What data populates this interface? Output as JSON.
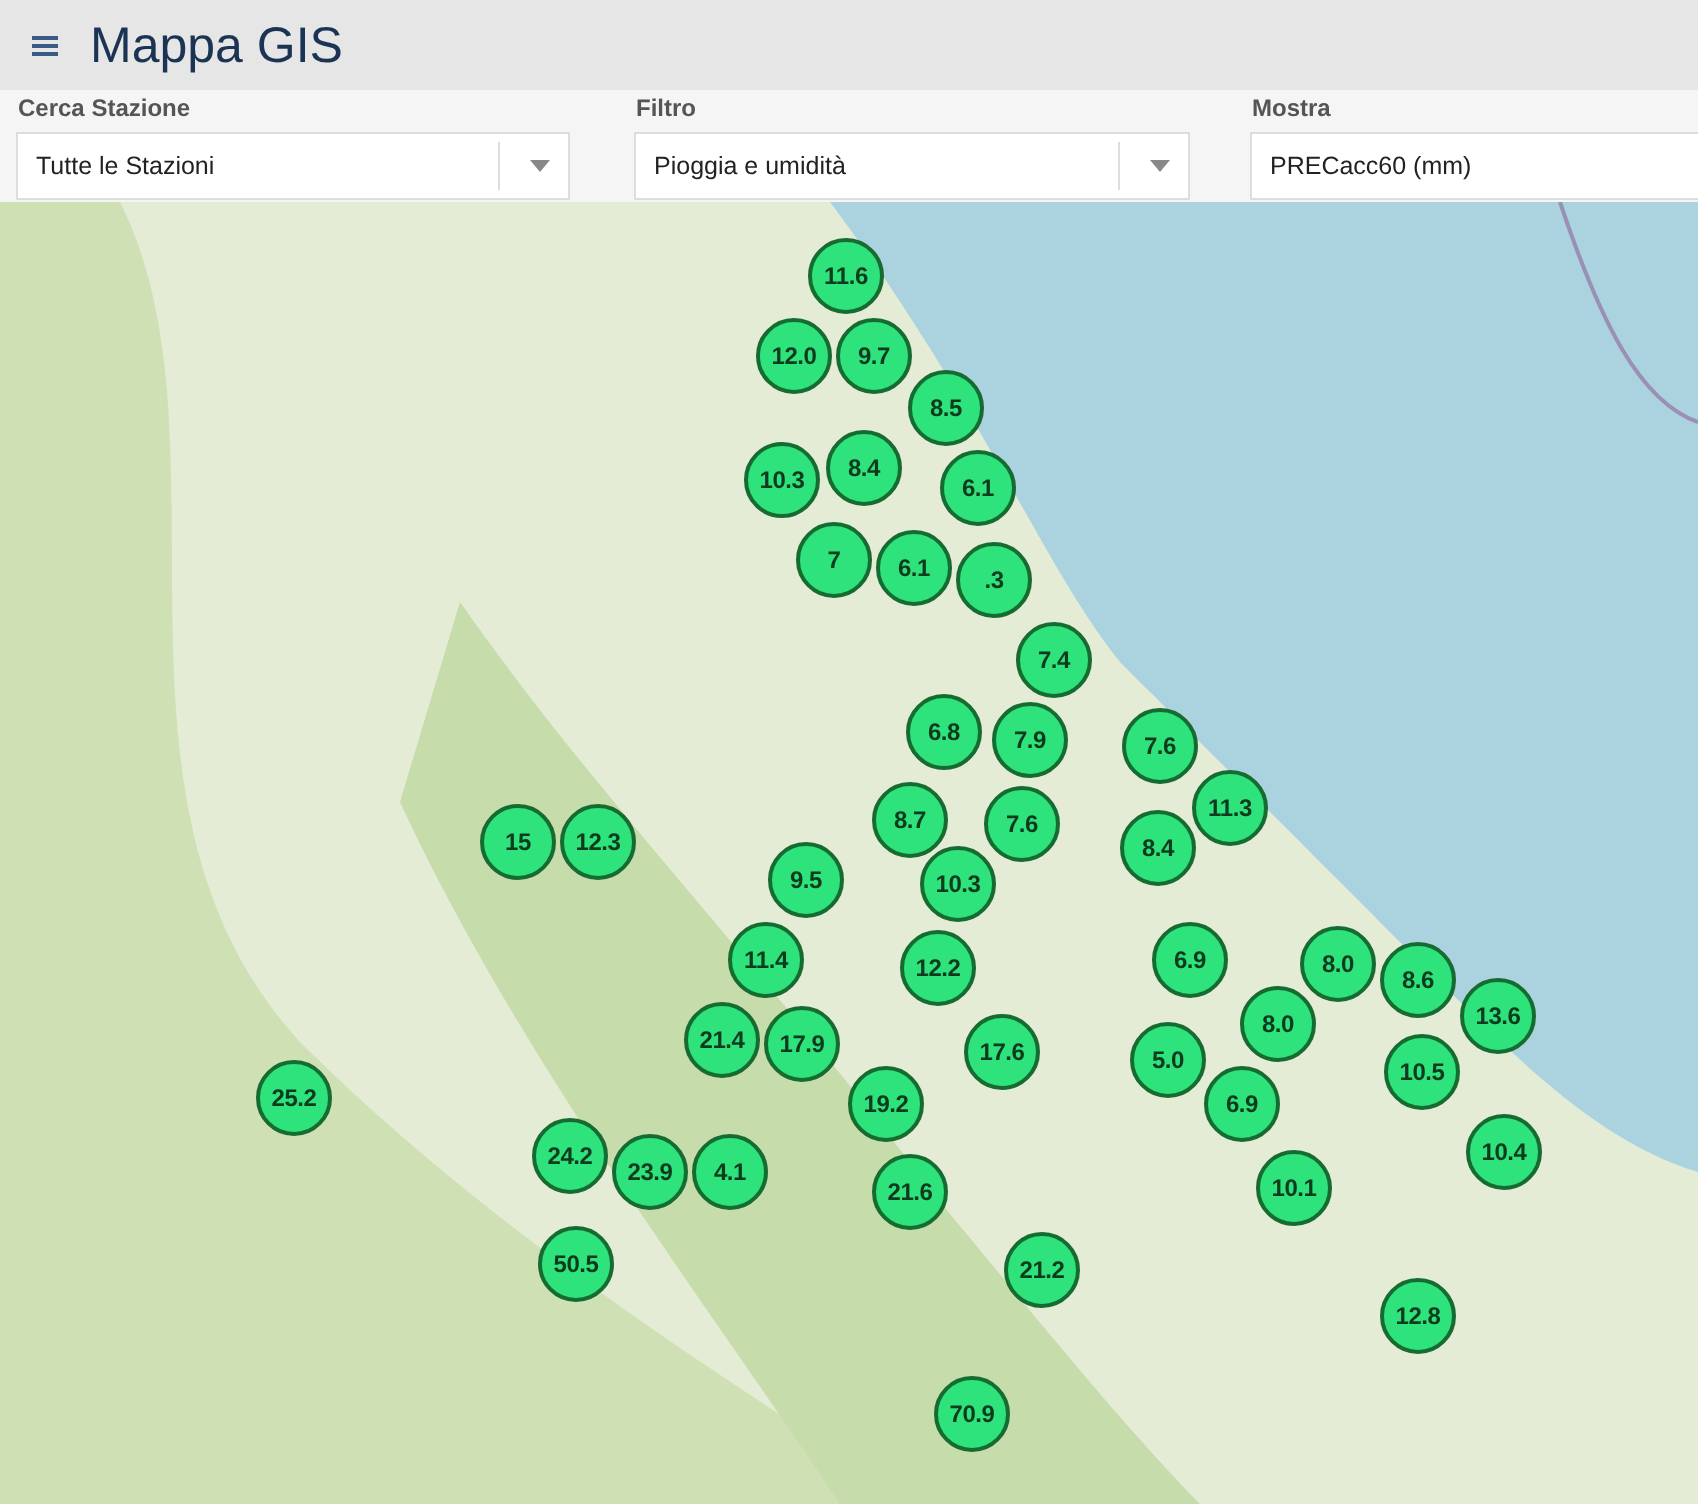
{
  "header": {
    "title": "Mappa GIS"
  },
  "filters": [
    {
      "label": "Cerca Stazione",
      "value": "Tutte le Stazioni",
      "kind": "dropdown"
    },
    {
      "label": "Filtro",
      "value": "Pioggia e umidità",
      "kind": "dropdown"
    },
    {
      "label": "Mostra",
      "value": "PRECacc60 (mm)",
      "kind": "text"
    }
  ],
  "map": {
    "markers": [
      {
        "value": "11.6"
      },
      {
        "value": "12.0"
      },
      {
        "value": "9.7"
      },
      {
        "value": "8.5"
      },
      {
        "value": "10.3"
      },
      {
        "value": "8.4"
      },
      {
        "value": "6.1"
      },
      {
        "value": "7"
      },
      {
        "value": "6.1"
      },
      {
        "value": ".3"
      },
      {
        "value": "7.4"
      },
      {
        "value": "6.8"
      },
      {
        "value": "7.9"
      },
      {
        "value": "7.6"
      },
      {
        "value": "15"
      },
      {
        "value": "12.3"
      },
      {
        "value": "8.7"
      },
      {
        "value": "7.6"
      },
      {
        "value": "8.4"
      },
      {
        "value": "11.3"
      },
      {
        "value": "9.5"
      },
      {
        "value": "10.3"
      },
      {
        "value": "11.4"
      },
      {
        "value": "12.2"
      },
      {
        "value": "6.9"
      },
      {
        "value": "8.0"
      },
      {
        "value": "8.6"
      },
      {
        "value": "21.4"
      },
      {
        "value": "17.9"
      },
      {
        "value": "17.6"
      },
      {
        "value": "5.0"
      },
      {
        "value": "8.0"
      },
      {
        "value": "13.6"
      },
      {
        "value": "25.2"
      },
      {
        "value": "19.2"
      },
      {
        "value": "6.9"
      },
      {
        "value": "10.5"
      },
      {
        "value": "24.2"
      },
      {
        "value": "23.9"
      },
      {
        "value": "4.1"
      },
      {
        "value": "21.6"
      },
      {
        "value": "10.1"
      },
      {
        "value": "10.4"
      },
      {
        "value": "50.5"
      },
      {
        "value": "21.2"
      },
      {
        "value": "12.8"
      },
      {
        "value": "70.9"
      }
    ]
  }
}
